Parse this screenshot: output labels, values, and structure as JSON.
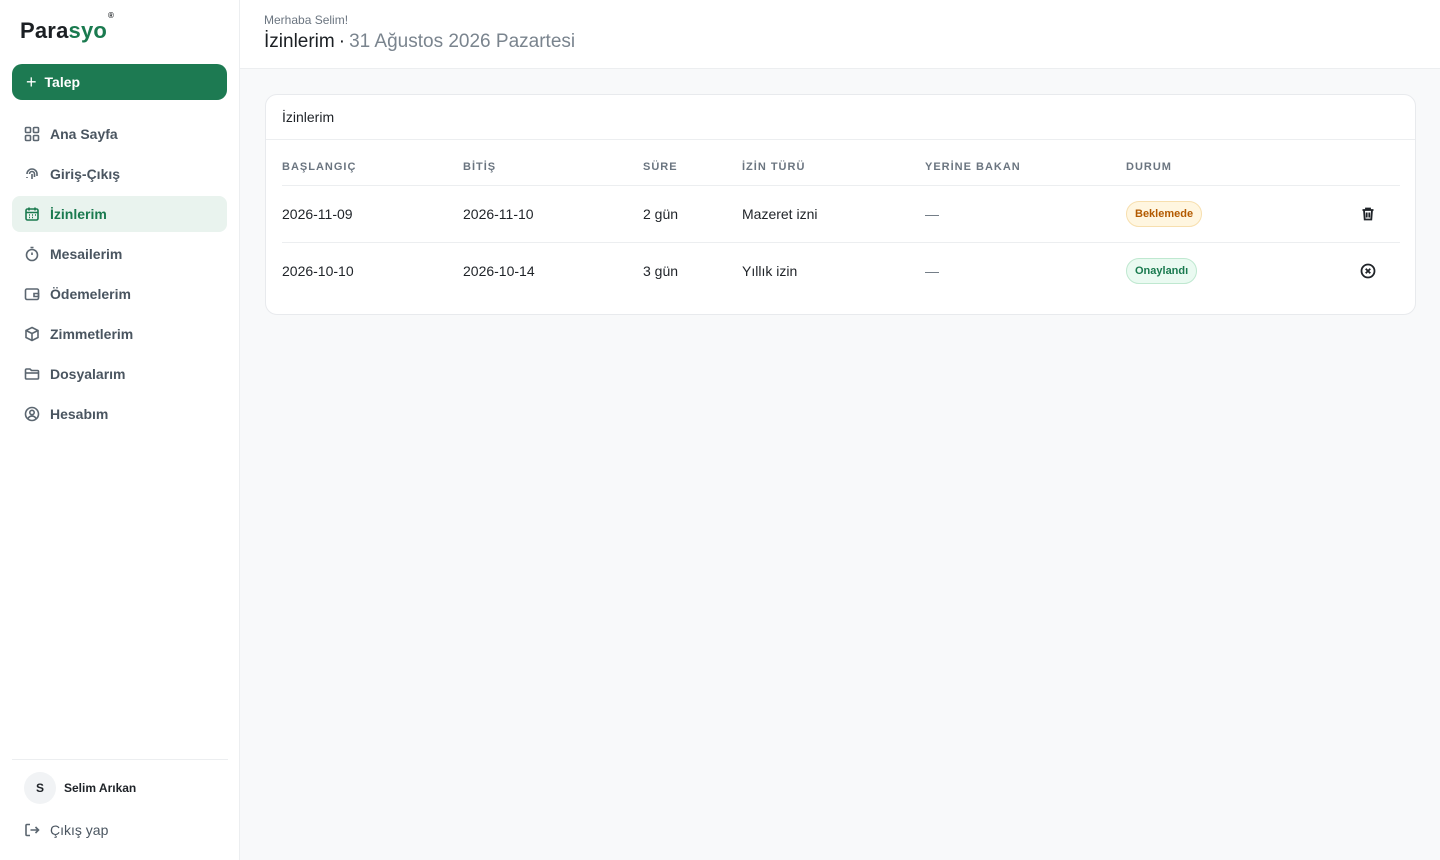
{
  "brand": {
    "name_part1": "Para",
    "name_part2": "syo",
    "mark": "®",
    "accent": "#1d7a52"
  },
  "sidebar": {
    "primary_button": "Talep",
    "items": [
      {
        "label": "Ana Sayfa",
        "icon": "dashboard-icon"
      },
      {
        "label": "Giriş-Çıkış",
        "icon": "fingerprint-icon"
      },
      {
        "label": "İzinlerim",
        "icon": "calendar-icon",
        "active": true
      },
      {
        "label": "Mesailerim",
        "icon": "timer-icon"
      },
      {
        "label": "Ödemelerim",
        "icon": "wallet-icon"
      },
      {
        "label": "Zimmetlerim",
        "icon": "box-icon"
      },
      {
        "label": "Dosyalarım",
        "icon": "folder-icon"
      },
      {
        "label": "Hesabım",
        "icon": "user-circle-icon"
      }
    ],
    "user": {
      "initial": "S",
      "name": "Selim Arıkan"
    },
    "logout": "Çıkış yap"
  },
  "header": {
    "greeting": "Merhaba Selim!",
    "title": "İzinlerim",
    "separator": "·",
    "date": "31 Ağustos 2026 Pazartesi"
  },
  "card": {
    "title": "İzinlerim",
    "columns": [
      "BAŞLANGIÇ",
      "BİTİŞ",
      "SÜRE",
      "İZİN TÜRÜ",
      "YERİNE BAKAN",
      "DURUM"
    ],
    "rows": [
      {
        "start": "2026-11-09",
        "end": "2026-11-10",
        "duration": "2 gün",
        "type": "Mazeret izni",
        "substitute": "—",
        "status": "Beklemede",
        "status_kind": "pending",
        "action": "trash-icon"
      },
      {
        "start": "2026-10-10",
        "end": "2026-10-14",
        "duration": "3 gün",
        "type": "Yıllık izin",
        "substitute": "—",
        "status": "Onaylandı",
        "status_kind": "approved",
        "action": "cancel-circle-icon"
      }
    ]
  }
}
